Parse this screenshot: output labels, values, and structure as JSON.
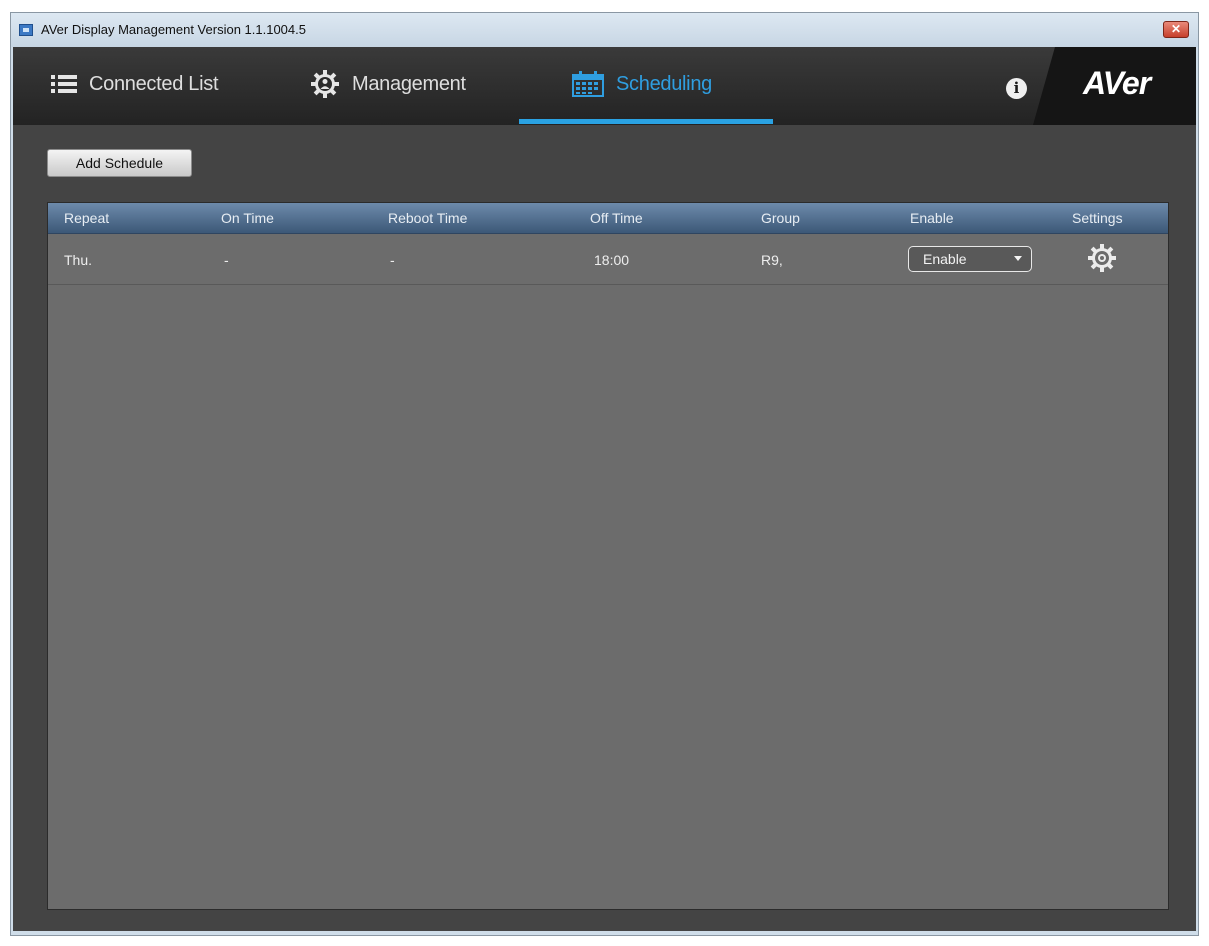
{
  "window": {
    "title": "AVer Display Management Version 1.1.1004.5",
    "close": "✕"
  },
  "nav": {
    "tabs": [
      {
        "label": "Connected List",
        "icon": "list-icon",
        "active": false
      },
      {
        "label": "Management",
        "icon": "gear-person-icon",
        "active": false
      },
      {
        "label": "Scheduling",
        "icon": "calendar-icon",
        "active": true
      }
    ],
    "info": "i",
    "logo": "AVer",
    "accent": "#2aa2e3"
  },
  "toolbar": {
    "add_schedule": "Add Schedule"
  },
  "table": {
    "columns": [
      "Repeat",
      "On Time",
      "Reboot Time",
      "Off Time",
      "Group",
      "Enable",
      "Settings"
    ],
    "rows": [
      {
        "repeat": "Thu.",
        "on_time": "-",
        "reboot_time": "-",
        "off_time": "18:00",
        "group": "R9,",
        "enable": "Enable",
        "settings_icon": "gear-icon"
      }
    ]
  }
}
